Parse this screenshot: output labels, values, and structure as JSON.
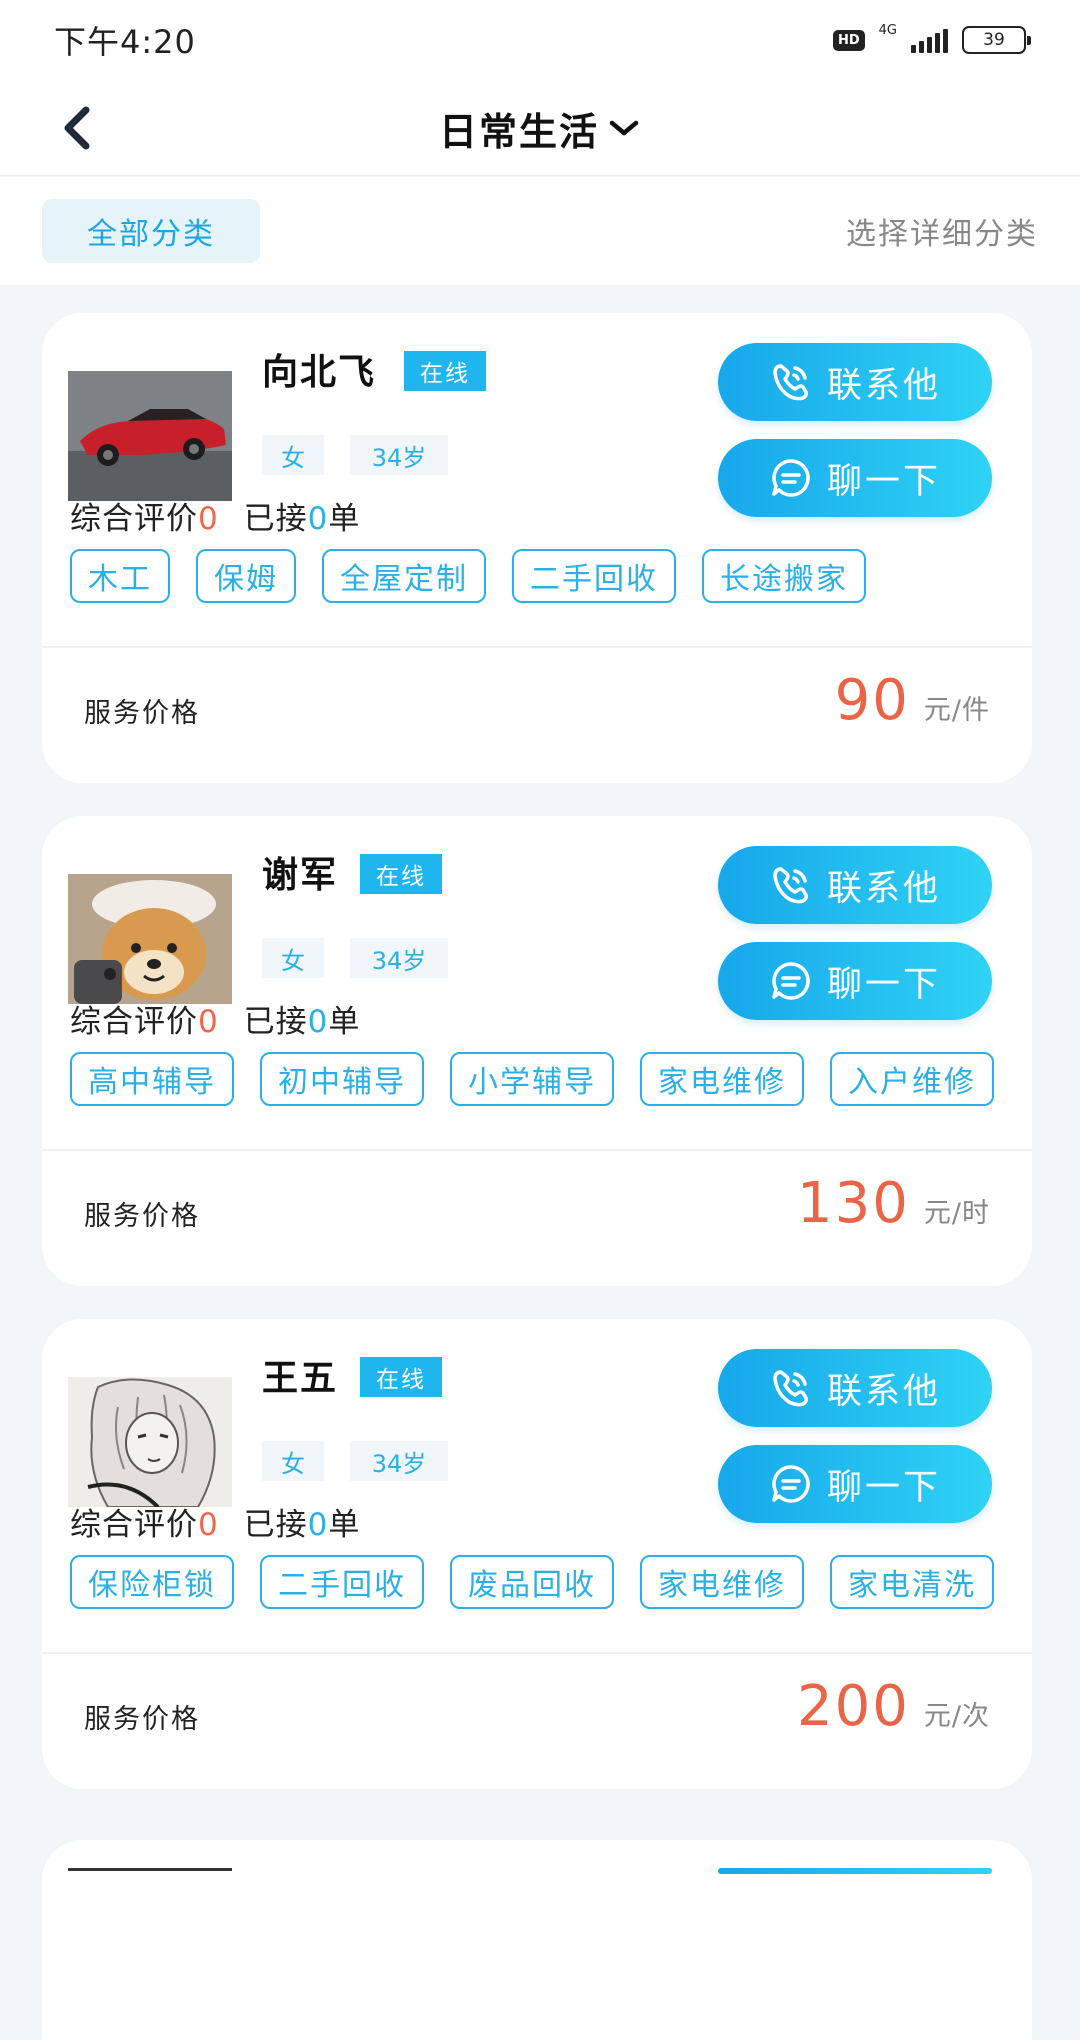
{
  "status_bar": {
    "time": "下午4:20",
    "hd": "HD",
    "network": "4G",
    "battery": "39"
  },
  "nav": {
    "title": "日常生活"
  },
  "filters": {
    "all_label": "全部分类",
    "detail_label": "选择详细分类"
  },
  "labels": {
    "online": "在线",
    "contact_btn": "联系他",
    "chat_btn": "聊一下",
    "rating_prefix": "综合评价",
    "orders_prefix": "已接",
    "orders_suffix": "单",
    "price_label": "服务价格"
  },
  "providers": [
    {
      "name": "向北飞",
      "gender": "女",
      "age": "34岁",
      "rating": "0",
      "orders": "0",
      "tags": [
        "木工",
        "保姆",
        "全屋定制",
        "二手回收",
        "长途搬家"
      ],
      "price": "90",
      "unit": "元/件",
      "avatar": "red-car"
    },
    {
      "name": "谢军",
      "gender": "女",
      "age": "34岁",
      "rating": "0",
      "orders": "0",
      "tags": [
        "高中辅导",
        "初中辅导",
        "小学辅导",
        "家电维修",
        "入户维修"
      ],
      "price": "130",
      "unit": "元/时",
      "avatar": "shiba-dog"
    },
    {
      "name": "王五",
      "gender": "女",
      "age": "34岁",
      "rating": "0",
      "orders": "0",
      "tags": [
        "保险柜锁",
        "二手回收",
        "废品回收",
        "家电维修",
        "家电清洗"
      ],
      "price": "200",
      "unit": "元/次",
      "avatar": "sketch-portrait"
    }
  ],
  "colors": {
    "accent": "#1fb5ee",
    "price": "#ea6548",
    "background": "#f1f6fa"
  }
}
